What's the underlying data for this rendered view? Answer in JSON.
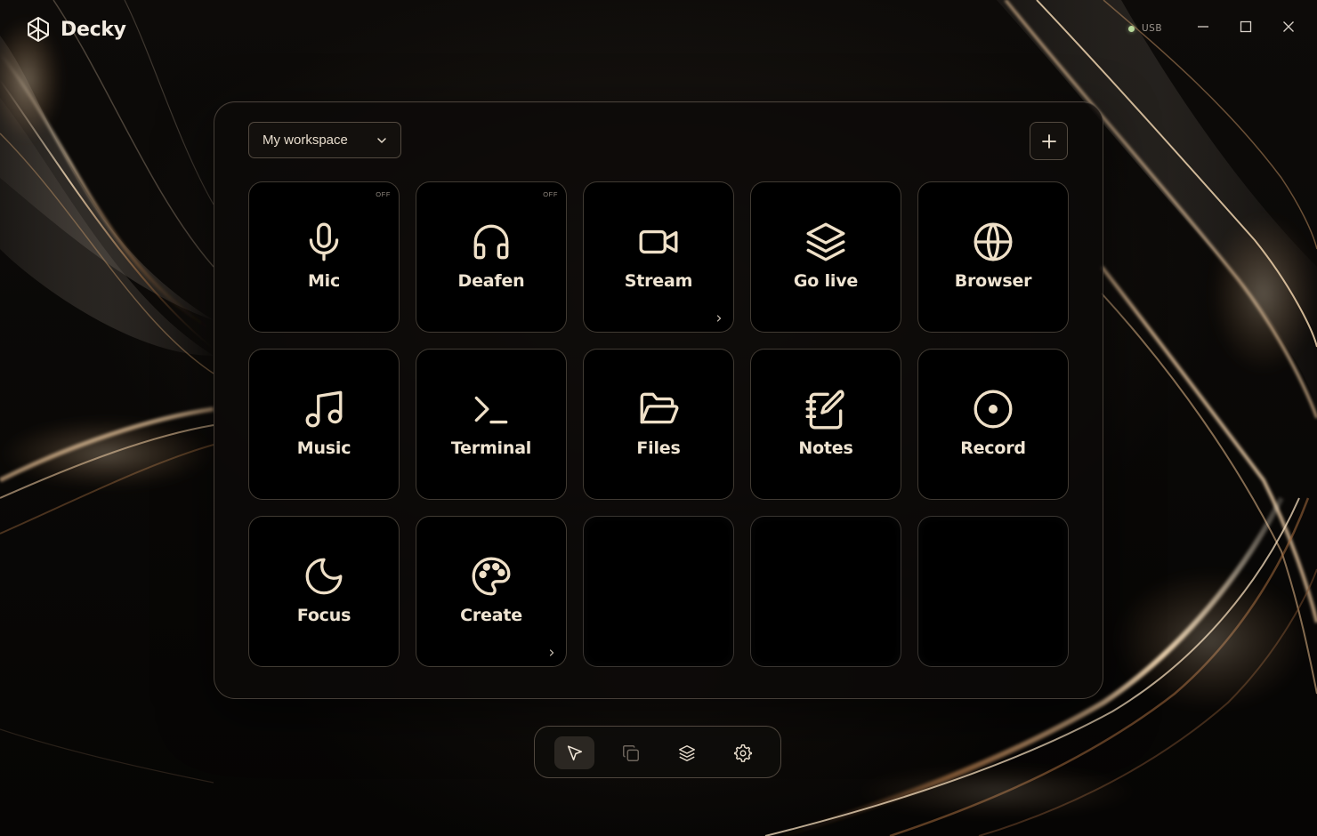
{
  "app": {
    "name": "Decky",
    "logo_icon": "decky-logo-icon"
  },
  "status": {
    "connection_label": "USB",
    "connection_color": "#b8d89a"
  },
  "window_controls": {
    "minimize_icon": "minimize-icon",
    "maximize_icon": "maximize-icon",
    "close_icon": "close-icon"
  },
  "workspace": {
    "selected": "My workspace",
    "dropdown_icon": "chevron-down-icon",
    "add_icon": "plus-icon"
  },
  "keys": [
    {
      "label": "Mic",
      "icon": "mic-icon",
      "badge": "OFF",
      "has_submenu": false
    },
    {
      "label": "Deafen",
      "icon": "headphones-icon",
      "badge": "OFF",
      "has_submenu": false
    },
    {
      "label": "Stream",
      "icon": "video-camera-icon",
      "badge": "",
      "has_submenu": true
    },
    {
      "label": "Go live",
      "icon": "layers-icon",
      "badge": "",
      "has_submenu": false
    },
    {
      "label": "Browser",
      "icon": "globe-icon",
      "badge": "",
      "has_submenu": false
    },
    {
      "label": "Music",
      "icon": "music-note-icon",
      "badge": "",
      "has_submenu": false
    },
    {
      "label": "Terminal",
      "icon": "terminal-icon",
      "badge": "",
      "has_submenu": false
    },
    {
      "label": "Files",
      "icon": "folder-open-icon",
      "badge": "",
      "has_submenu": false
    },
    {
      "label": "Notes",
      "icon": "notebook-pen-icon",
      "badge": "",
      "has_submenu": false
    },
    {
      "label": "Record",
      "icon": "record-icon",
      "badge": "",
      "has_submenu": false
    },
    {
      "label": "Focus",
      "icon": "moon-icon",
      "badge": "",
      "has_submenu": false
    },
    {
      "label": "Create",
      "icon": "palette-icon",
      "badge": "",
      "has_submenu": true
    },
    {
      "label": "",
      "icon": "",
      "badge": "",
      "has_submenu": false
    },
    {
      "label": "",
      "icon": "",
      "badge": "",
      "has_submenu": false
    },
    {
      "label": "",
      "icon": "",
      "badge": "",
      "has_submenu": false
    }
  ],
  "toolbar": {
    "tools": [
      {
        "icon": "cursor-select-icon",
        "active": true
      },
      {
        "icon": "copy-icon",
        "active": false,
        "disabled": true
      },
      {
        "icon": "layers-icon",
        "active": false
      },
      {
        "icon": "gear-icon",
        "active": false
      }
    ]
  },
  "colors": {
    "accent": "#e8d3b5",
    "text": "#efe4d2",
    "panel_border": "#d7c3aa",
    "background": "#050403"
  }
}
